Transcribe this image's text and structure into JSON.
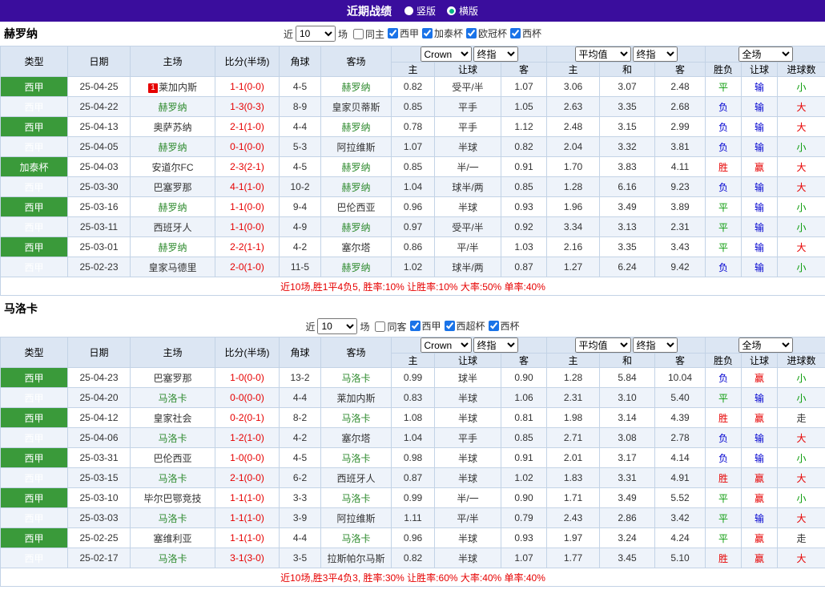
{
  "topbar": {
    "title": "近期战绩",
    "radios": [
      {
        "label": "竖版",
        "selected": false
      },
      {
        "label": "横版",
        "selected": true
      }
    ]
  },
  "labels": {
    "near": "近",
    "games": "场",
    "cols": [
      "类型",
      "日期",
      "主场",
      "比分(半场)",
      "角球",
      "客场"
    ],
    "sub": [
      "主",
      "让球",
      "客",
      "主",
      "和",
      "客",
      "胜负",
      "让球",
      "进球数"
    ]
  },
  "colors": {
    "topbar_bg": "#3a0d9d",
    "radio_selected": "#00b386",
    "header_bg": "#dce6f3",
    "border": "#c3d3e6",
    "row_alt": "#eef3fa",
    "type_bg": "#3a9a3a",
    "focal_team": "#2d8a2d",
    "score": "#e60000",
    "win": "#e60000",
    "draw": "#089b08",
    "loss": "#0000d0",
    "push": "#333333",
    "summary": "#e60000"
  },
  "sections": [
    {
      "team": "赫罗纳",
      "filter": {
        "count": "10",
        "same_label": "同主",
        "same_checked": false,
        "leagues": [
          {
            "label": "西甲",
            "checked": true
          },
          {
            "label": "加泰杯",
            "checked": true
          },
          {
            "label": "欧冠杯",
            "checked": true
          },
          {
            "label": "西杯",
            "checked": true
          }
        ]
      },
      "header": {
        "bookmaker": "Crown",
        "ah_stage": "终指",
        "eu_source": "平均值",
        "eu_stage": "终指",
        "scope": "全场"
      },
      "rows": [
        {
          "type": "西甲",
          "date": "25-04-25",
          "home": "莱加内斯",
          "badge": "1",
          "home_focus": false,
          "score": "1-1(0-0)",
          "corner": "4-5",
          "away": "赫罗纳",
          "away_focus": true,
          "ah": [
            "0.82",
            "受平/半",
            "1.07"
          ],
          "eu": [
            "3.06",
            "3.07",
            "2.48"
          ],
          "res": [
            "平",
            "输",
            "小"
          ]
        },
        {
          "type": "西甲",
          "date": "25-04-22",
          "home": "赫罗纳",
          "home_focus": true,
          "score": "1-3(0-3)",
          "corner": "8-9",
          "away": "皇家贝蒂斯",
          "away_focus": false,
          "ah": [
            "0.85",
            "平手",
            "1.05"
          ],
          "eu": [
            "2.63",
            "3.35",
            "2.68"
          ],
          "res": [
            "负",
            "输",
            "大"
          ]
        },
        {
          "type": "西甲",
          "date": "25-04-13",
          "home": "奥萨苏纳",
          "home_focus": false,
          "score": "2-1(1-0)",
          "corner": "4-4",
          "away": "赫罗纳",
          "away_focus": true,
          "ah": [
            "0.78",
            "平手",
            "1.12"
          ],
          "eu": [
            "2.48",
            "3.15",
            "2.99"
          ],
          "res": [
            "负",
            "输",
            "大"
          ]
        },
        {
          "type": "西甲",
          "date": "25-04-05",
          "home": "赫罗纳",
          "home_focus": true,
          "score": "0-1(0-0)",
          "corner": "5-3",
          "away": "阿拉维斯",
          "away_focus": false,
          "ah": [
            "1.07",
            "半球",
            "0.82"
          ],
          "eu": [
            "2.04",
            "3.32",
            "3.81"
          ],
          "res": [
            "负",
            "输",
            "小"
          ]
        },
        {
          "type": "加泰杯",
          "date": "25-04-03",
          "home": "安道尔FC",
          "home_focus": false,
          "score": "2-3(2-1)",
          "corner": "4-5",
          "away": "赫罗纳",
          "away_focus": true,
          "ah": [
            "0.85",
            "半/一",
            "0.91"
          ],
          "eu": [
            "1.70",
            "3.83",
            "4.11"
          ],
          "res": [
            "胜",
            "赢",
            "大"
          ]
        },
        {
          "type": "西甲",
          "date": "25-03-30",
          "home": "巴塞罗那",
          "home_focus": false,
          "score": "4-1(1-0)",
          "corner": "10-2",
          "away": "赫罗纳",
          "away_focus": true,
          "ah": [
            "1.04",
            "球半/两",
            "0.85"
          ],
          "eu": [
            "1.28",
            "6.16",
            "9.23"
          ],
          "res": [
            "负",
            "输",
            "大"
          ]
        },
        {
          "type": "西甲",
          "date": "25-03-16",
          "home": "赫罗纳",
          "home_focus": true,
          "score": "1-1(0-0)",
          "corner": "9-4",
          "away": "巴伦西亚",
          "away_focus": false,
          "ah": [
            "0.96",
            "半球",
            "0.93"
          ],
          "eu": [
            "1.96",
            "3.49",
            "3.89"
          ],
          "res": [
            "平",
            "输",
            "小"
          ]
        },
        {
          "type": "西甲",
          "date": "25-03-11",
          "home": "西班牙人",
          "home_focus": false,
          "score": "1-1(0-0)",
          "corner": "4-9",
          "away": "赫罗纳",
          "away_focus": true,
          "ah": [
            "0.97",
            "受平/半",
            "0.92"
          ],
          "eu": [
            "3.34",
            "3.13",
            "2.31"
          ],
          "res": [
            "平",
            "输",
            "小"
          ]
        },
        {
          "type": "西甲",
          "date": "25-03-01",
          "home": "赫罗纳",
          "home_focus": true,
          "score": "2-2(1-1)",
          "corner": "4-2",
          "away": "塞尔塔",
          "away_focus": false,
          "ah": [
            "0.86",
            "平/半",
            "1.03"
          ],
          "eu": [
            "2.16",
            "3.35",
            "3.43"
          ],
          "res": [
            "平",
            "输",
            "大"
          ]
        },
        {
          "type": "西甲",
          "date": "25-02-23",
          "home": "皇家马德里",
          "home_focus": false,
          "score": "2-0(1-0)",
          "corner": "11-5",
          "away": "赫罗纳",
          "away_focus": true,
          "ah": [
            "1.02",
            "球半/两",
            "0.87"
          ],
          "eu": [
            "1.27",
            "6.24",
            "9.42"
          ],
          "res": [
            "负",
            "输",
            "小"
          ]
        }
      ],
      "summary": "近10场,胜1平4负5, 胜率:10% 让胜率:10% 大率:50% 单率:40%"
    },
    {
      "team": "马洛卡",
      "filter": {
        "count": "10",
        "same_label": "同客",
        "same_checked": false,
        "leagues": [
          {
            "label": "西甲",
            "checked": true
          },
          {
            "label": "西超杯",
            "checked": true
          },
          {
            "label": "西杯",
            "checked": true
          }
        ]
      },
      "header": {
        "bookmaker": "Crown",
        "ah_stage": "终指",
        "eu_source": "平均值",
        "eu_stage": "终指",
        "scope": "全场"
      },
      "rows": [
        {
          "type": "西甲",
          "date": "25-04-23",
          "home": "巴塞罗那",
          "home_focus": false,
          "score": "1-0(0-0)",
          "corner": "13-2",
          "away": "马洛卡",
          "away_focus": true,
          "ah": [
            "0.99",
            "球半",
            "0.90"
          ],
          "eu": [
            "1.28",
            "5.84",
            "10.04"
          ],
          "res": [
            "负",
            "赢",
            "小"
          ]
        },
        {
          "type": "西甲",
          "date": "25-04-20",
          "home": "马洛卡",
          "home_focus": true,
          "score": "0-0(0-0)",
          "corner": "4-4",
          "away": "莱加内斯",
          "away_focus": false,
          "ah": [
            "0.83",
            "半球",
            "1.06"
          ],
          "eu": [
            "2.31",
            "3.10",
            "5.40"
          ],
          "res": [
            "平",
            "输",
            "小"
          ]
        },
        {
          "type": "西甲",
          "date": "25-04-12",
          "home": "皇家社会",
          "home_focus": false,
          "score": "0-2(0-1)",
          "corner": "8-2",
          "away": "马洛卡",
          "away_focus": true,
          "ah": [
            "1.08",
            "半球",
            "0.81"
          ],
          "eu": [
            "1.98",
            "3.14",
            "4.39"
          ],
          "res": [
            "胜",
            "赢",
            "走"
          ]
        },
        {
          "type": "西甲",
          "date": "25-04-06",
          "home": "马洛卡",
          "home_focus": true,
          "score": "1-2(1-0)",
          "corner": "4-2",
          "away": "塞尔塔",
          "away_focus": false,
          "ah": [
            "1.04",
            "平手",
            "0.85"
          ],
          "eu": [
            "2.71",
            "3.08",
            "2.78"
          ],
          "res": [
            "负",
            "输",
            "大"
          ]
        },
        {
          "type": "西甲",
          "date": "25-03-31",
          "home": "巴伦西亚",
          "home_focus": false,
          "score": "1-0(0-0)",
          "corner": "4-5",
          "away": "马洛卡",
          "away_focus": true,
          "ah": [
            "0.98",
            "半球",
            "0.91"
          ],
          "eu": [
            "2.01",
            "3.17",
            "4.14"
          ],
          "res": [
            "负",
            "输",
            "小"
          ]
        },
        {
          "type": "西甲",
          "date": "25-03-15",
          "home": "马洛卡",
          "home_focus": true,
          "score": "2-1(0-0)",
          "corner": "6-2",
          "away": "西班牙人",
          "away_focus": false,
          "ah": [
            "0.87",
            "半球",
            "1.02"
          ],
          "eu": [
            "1.83",
            "3.31",
            "4.91"
          ],
          "res": [
            "胜",
            "赢",
            "大"
          ]
        },
        {
          "type": "西甲",
          "date": "25-03-10",
          "home": "毕尔巴鄂竞技",
          "home_focus": false,
          "score": "1-1(1-0)",
          "corner": "3-3",
          "away": "马洛卡",
          "away_focus": true,
          "ah": [
            "0.99",
            "半/一",
            "0.90"
          ],
          "eu": [
            "1.71",
            "3.49",
            "5.52"
          ],
          "res": [
            "平",
            "赢",
            "小"
          ]
        },
        {
          "type": "西甲",
          "date": "25-03-03",
          "home": "马洛卡",
          "home_focus": true,
          "score": "1-1(1-0)",
          "corner": "3-9",
          "away": "阿拉维斯",
          "away_focus": false,
          "ah": [
            "1.11",
            "平/半",
            "0.79"
          ],
          "eu": [
            "2.43",
            "2.86",
            "3.42"
          ],
          "res": [
            "平",
            "输",
            "大"
          ]
        },
        {
          "type": "西甲",
          "date": "25-02-25",
          "home": "塞维利亚",
          "home_focus": false,
          "score": "1-1(1-0)",
          "corner": "4-4",
          "away": "马洛卡",
          "away_focus": true,
          "ah": [
            "0.96",
            "半球",
            "0.93"
          ],
          "eu": [
            "1.97",
            "3.24",
            "4.24"
          ],
          "res": [
            "平",
            "赢",
            "走"
          ]
        },
        {
          "type": "西甲",
          "date": "25-02-17",
          "home": "马洛卡",
          "home_focus": true,
          "score": "3-1(3-0)",
          "corner": "3-5",
          "away": "拉斯帕尔马斯",
          "away_focus": false,
          "ah": [
            "0.82",
            "半球",
            "1.07"
          ],
          "eu": [
            "1.77",
            "3.45",
            "5.10"
          ],
          "res": [
            "胜",
            "赢",
            "大"
          ]
        }
      ],
      "summary": "近10场,胜3平4负3, 胜率:30% 让胜率:60% 大率:40% 单率:40%"
    }
  ]
}
